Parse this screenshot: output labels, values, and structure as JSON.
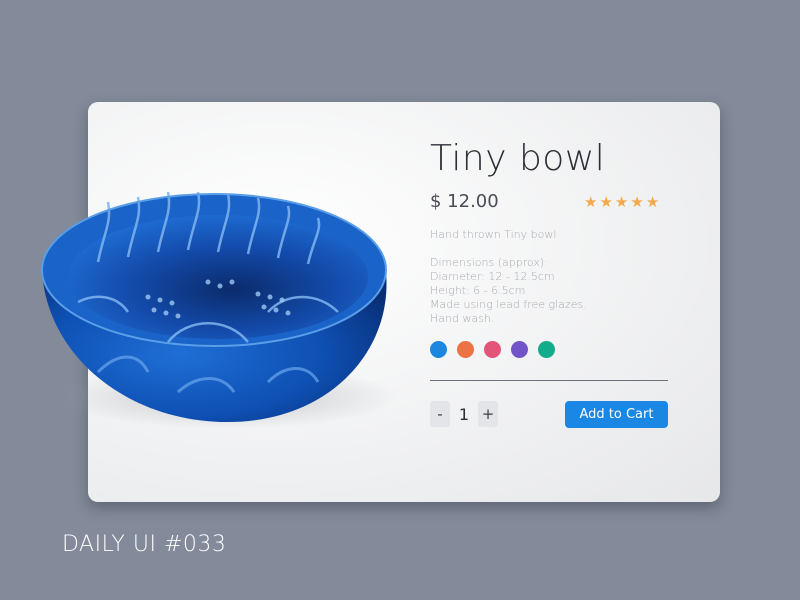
{
  "product": {
    "title": "Tiny bowl",
    "price": "$ 12.00",
    "rating": 5,
    "rating_max": 5,
    "star_color": "#f5a84c",
    "description": [
      "Hand thrown Tiny bowl",
      "",
      "Dimensions (approx):",
      "Diameter: 12 - 12.5cm",
      "Height: 6 - 6.5cm",
      "Made using lead free glazes.",
      "Hand wash."
    ],
    "colors": [
      "#1d87df",
      "#ec7444",
      "#e25579",
      "#7154c8",
      "#12ac8d"
    ]
  },
  "quantity": {
    "minus_label": "-",
    "value": "1",
    "plus_label": "+"
  },
  "cart_button_label": "Add to Cart",
  "footer_label": "DAILY UI #033"
}
